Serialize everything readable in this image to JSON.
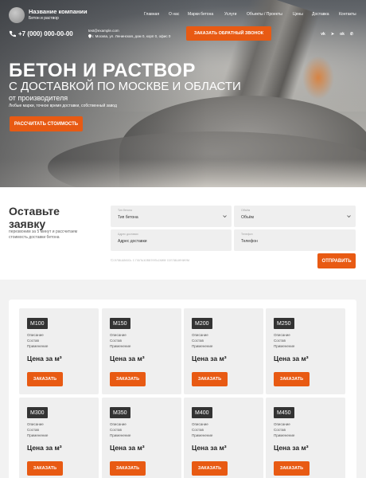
{
  "header": {
    "company_name": "Название компании",
    "company_sub": "Бетон и раствор",
    "nav": [
      "Главная",
      "О нас",
      "Марки бетона",
      "Услуги",
      "Объекты / Проекты",
      "Цены",
      "Доставка",
      "Контакты"
    ],
    "phone": "+7 (000) 000-00-00",
    "email": "test@example.com",
    "address": "г. Москва, ул. Ленинская, дом 0, корп 0, офис 0",
    "callback_label": "ЗАКАЗАТЬ ОБРАТНЫЙ ЗВОНОК",
    "social": [
      {
        "icon": "vk-icon",
        "glyph": "vk"
      },
      {
        "icon": "telegram-icon",
        "glyph": "➤"
      },
      {
        "icon": "odnoklassniki-icon",
        "glyph": "ok"
      },
      {
        "icon": "whatsapp-icon",
        "glyph": "✆"
      }
    ]
  },
  "hero": {
    "title": "БЕТОН И РАСТВОР",
    "line2": "С ДОСТАВКОЙ ПО МОСКВЕ И ОБЛАСТИ",
    "line3": "от производителя",
    "line4": "Любые марки, точное время доставки, собственный завод",
    "cta_label": "РАССЧИТАТЬ СТОИМОСТЬ"
  },
  "request_form": {
    "title": "Оставьте заявку",
    "description": "перезвоним за 5 минут и рассчитаем стоимость доставки бетона",
    "fields": {
      "concrete_type": {
        "label": "Тип бетона",
        "value": "Тип бетона"
      },
      "volume": {
        "label": "Объём",
        "value": "Объём"
      },
      "address": {
        "label": "Адрес доставки",
        "value": "Адрес доставки"
      },
      "phone": {
        "label": "Телефон",
        "value": "Телефон"
      }
    },
    "consent": "Соглашаюсь с пользовательским соглашением",
    "submit_label": "ОТПРАВИТЬ"
  },
  "products": [
    {
      "grade": "M100",
      "line1": "Описание",
      "line2": "Состав",
      "line3": "Применение",
      "price": "Цена за м³",
      "button": "ЗАКАЗАТЬ"
    },
    {
      "grade": "M150",
      "line1": "Описание",
      "line2": "Состав",
      "line3": "Применение",
      "price": "Цена за м³",
      "button": "ЗАКАЗАТЬ"
    },
    {
      "grade": "M200",
      "line1": "Описание",
      "line2": "Состав",
      "line3": "Применение",
      "price": "Цена за м³",
      "button": "ЗАКАЗАТЬ"
    },
    {
      "grade": "M250",
      "line1": "Описание",
      "line2": "Состав",
      "line3": "Применение",
      "price": "Цена за м³",
      "button": "ЗАКАЗАТЬ"
    },
    {
      "grade": "M300",
      "line1": "Описание",
      "line2": "Состав",
      "line3": "Применение",
      "price": "Цена за м³",
      "button": "ЗАКАЗАТЬ"
    },
    {
      "grade": "M350",
      "line1": "Описание",
      "line2": "Состав",
      "line3": "Применение",
      "price": "Цена за м³",
      "button": "ЗАКАЗАТЬ"
    },
    {
      "grade": "M400",
      "line1": "Описание",
      "line2": "Состав",
      "line3": "Применение",
      "price": "Цена за м³",
      "button": "ЗАКАЗАТЬ"
    },
    {
      "grade": "M450",
      "line1": "Описание",
      "line2": "Состав",
      "line3": "Применение",
      "price": "Цена за м³",
      "button": "ЗАКАЗАТЬ"
    }
  ],
  "colors": {
    "accent": "#e85a13",
    "badge": "#333333",
    "card_bg": "#efefef"
  }
}
